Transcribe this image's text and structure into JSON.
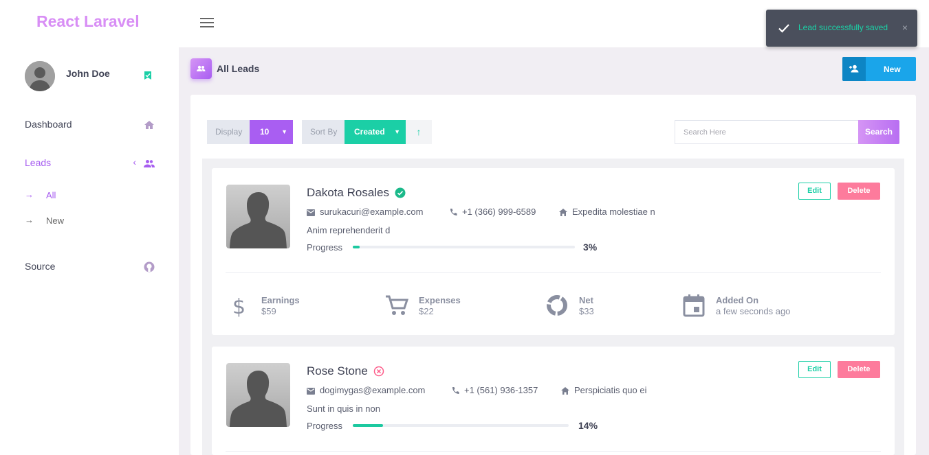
{
  "brand": "React Laravel",
  "user": {
    "name": "John Doe"
  },
  "nav": {
    "dashboard": "Dashboard",
    "leads": "Leads",
    "leads_all": "All",
    "leads_new": "New",
    "source": "Source"
  },
  "toast": {
    "message": "Lead successfully saved",
    "close": "×"
  },
  "header": {
    "title": "All Leads",
    "new_label": "New"
  },
  "toolbar": {
    "display_label": "Display",
    "display_value": "10",
    "sort_label": "Sort By",
    "sort_value": "Created",
    "sort_dir": "↑",
    "search_placeholder": "Search Here",
    "search_label": "Search"
  },
  "colors": {
    "accent": "#a75ef0",
    "teal": "#1bcfa6",
    "danger": "#fd7b9c",
    "brand": "#d88ef5"
  },
  "leads": [
    {
      "name": "Dakota Rosales",
      "verified": true,
      "email": "surukacuri@example.com",
      "phone": "+1 (366) 999-6589",
      "address": "Expedita molestiae n",
      "description": "Anim reprehenderit d",
      "progress_label": "Progress",
      "progress": 3,
      "progress_text": "3%",
      "edit": "Edit",
      "delete": "Delete",
      "stats": {
        "earnings_label": "Earnings",
        "earnings": "$59",
        "expenses_label": "Expenses",
        "expenses": "$22",
        "net_label": "Net",
        "net": "$33",
        "added_label": "Added On",
        "added": "a few seconds ago"
      }
    },
    {
      "name": "Rose Stone",
      "verified": false,
      "email": "dogimygas@example.com",
      "phone": "+1 (561) 936-1357",
      "address": "Perspiciatis quo ei",
      "description": "Sunt in quis in non",
      "progress_label": "Progress",
      "progress": 14,
      "progress_text": "14%",
      "edit": "Edit",
      "delete": "Delete"
    }
  ]
}
